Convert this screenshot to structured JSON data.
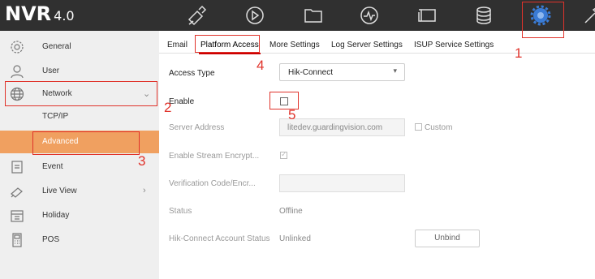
{
  "app": {
    "brand": "NVR",
    "version": "4.0"
  },
  "topbar_icons": [
    "live-view-camera-icon",
    "playback-icon",
    "file-folder-icon",
    "smart-analysis-icon",
    "camera-management-icon",
    "storage-icon",
    "configuration-gear-icon",
    "maintenance-icon"
  ],
  "sidebar": {
    "items": [
      {
        "label": "General"
      },
      {
        "label": "User"
      },
      {
        "label": "Network",
        "arrow": "⌄"
      },
      {
        "label": "TCP/IP"
      },
      {
        "label": "Advanced"
      },
      {
        "label": "Event"
      },
      {
        "label": "Live View",
        "arrow": "›"
      },
      {
        "label": "Holiday"
      },
      {
        "label": "POS"
      }
    ]
  },
  "tabs": [
    {
      "label": "Email"
    },
    {
      "label": "Platform Access"
    },
    {
      "label": "More Settings"
    },
    {
      "label": "Log Server Settings"
    },
    {
      "label": "ISUP Service Settings"
    }
  ],
  "form": {
    "access_type_label": "Access Type",
    "access_type_value": "Hik-Connect",
    "enable_label": "Enable",
    "server_address_label": "Server Address",
    "server_address_value": "litedev.guardingvision.com",
    "custom_label": "Custom",
    "stream_encrypt_label": "Enable Stream Encrypt...",
    "verification_label": "Verification Code/Encr...",
    "verification_value": "",
    "status_label": "Status",
    "status_value": "Offline",
    "account_status_label": "Hik-Connect Account Status",
    "account_status_value": "Unlinked",
    "unbind_label": "Unbind"
  },
  "annotations": {
    "n1": "1",
    "n2": "2",
    "n3": "3",
    "n4": "4",
    "n5": "5"
  },
  "colors": {
    "topbar": "#303030",
    "sidebar": "#efefef",
    "active_item": "#f0a060",
    "gear_active": "#3a7bd5",
    "annotation": "#e0332b"
  }
}
